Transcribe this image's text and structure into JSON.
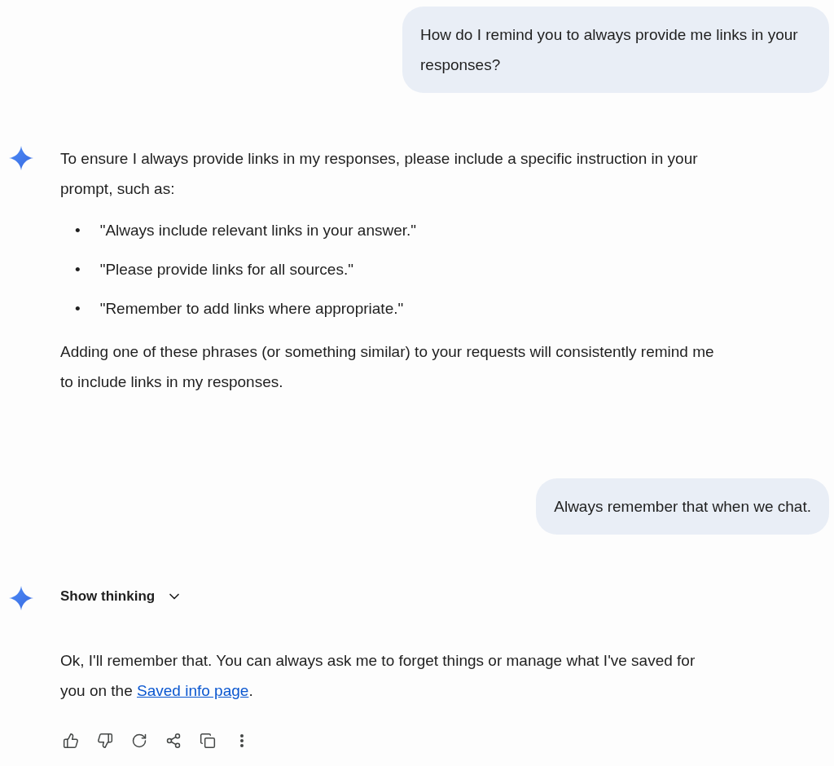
{
  "messages": [
    {
      "kind": "user",
      "text": "How do I remind you to always provide me links in your responses?"
    },
    {
      "kind": "model",
      "blocks": [
        {
          "kind": "paragraph",
          "text": "To ensure I always provide links in my responses, please include a specific instruction in your prompt, such as:"
        },
        {
          "kind": "bullets",
          "items": [
            {
              "marker": "•",
              "text": "\"Always include relevant links in your answer.\""
            },
            {
              "marker": "•",
              "text": "\"Please provide links for all sources.\""
            },
            {
              "marker": "•",
              "text": "\"Remember to add links where appropriate.\""
            }
          ]
        },
        {
          "kind": "paragraph",
          "text": "Adding one of these phrases (or something similar) to your requests will consistently remind me to include links in my responses."
        }
      ]
    },
    {
      "kind": "user",
      "text": "Always remember that when we chat."
    },
    {
      "kind": "model",
      "thinking": {
        "label": "Show thinking",
        "expanded": false
      },
      "blocks": [
        {
          "kind": "linked_paragraph",
          "before": "Ok, I'll remember that. You can always ask me to forget things or manage what I've saved for you on the ",
          "link": "Saved info page",
          "after": "."
        }
      ],
      "actions": [
        {
          "kind": "like"
        },
        {
          "kind": "dislike"
        },
        {
          "kind": "redo"
        },
        {
          "kind": "share"
        },
        {
          "kind": "copy"
        },
        {
          "kind": "more"
        }
      ]
    }
  ]
}
